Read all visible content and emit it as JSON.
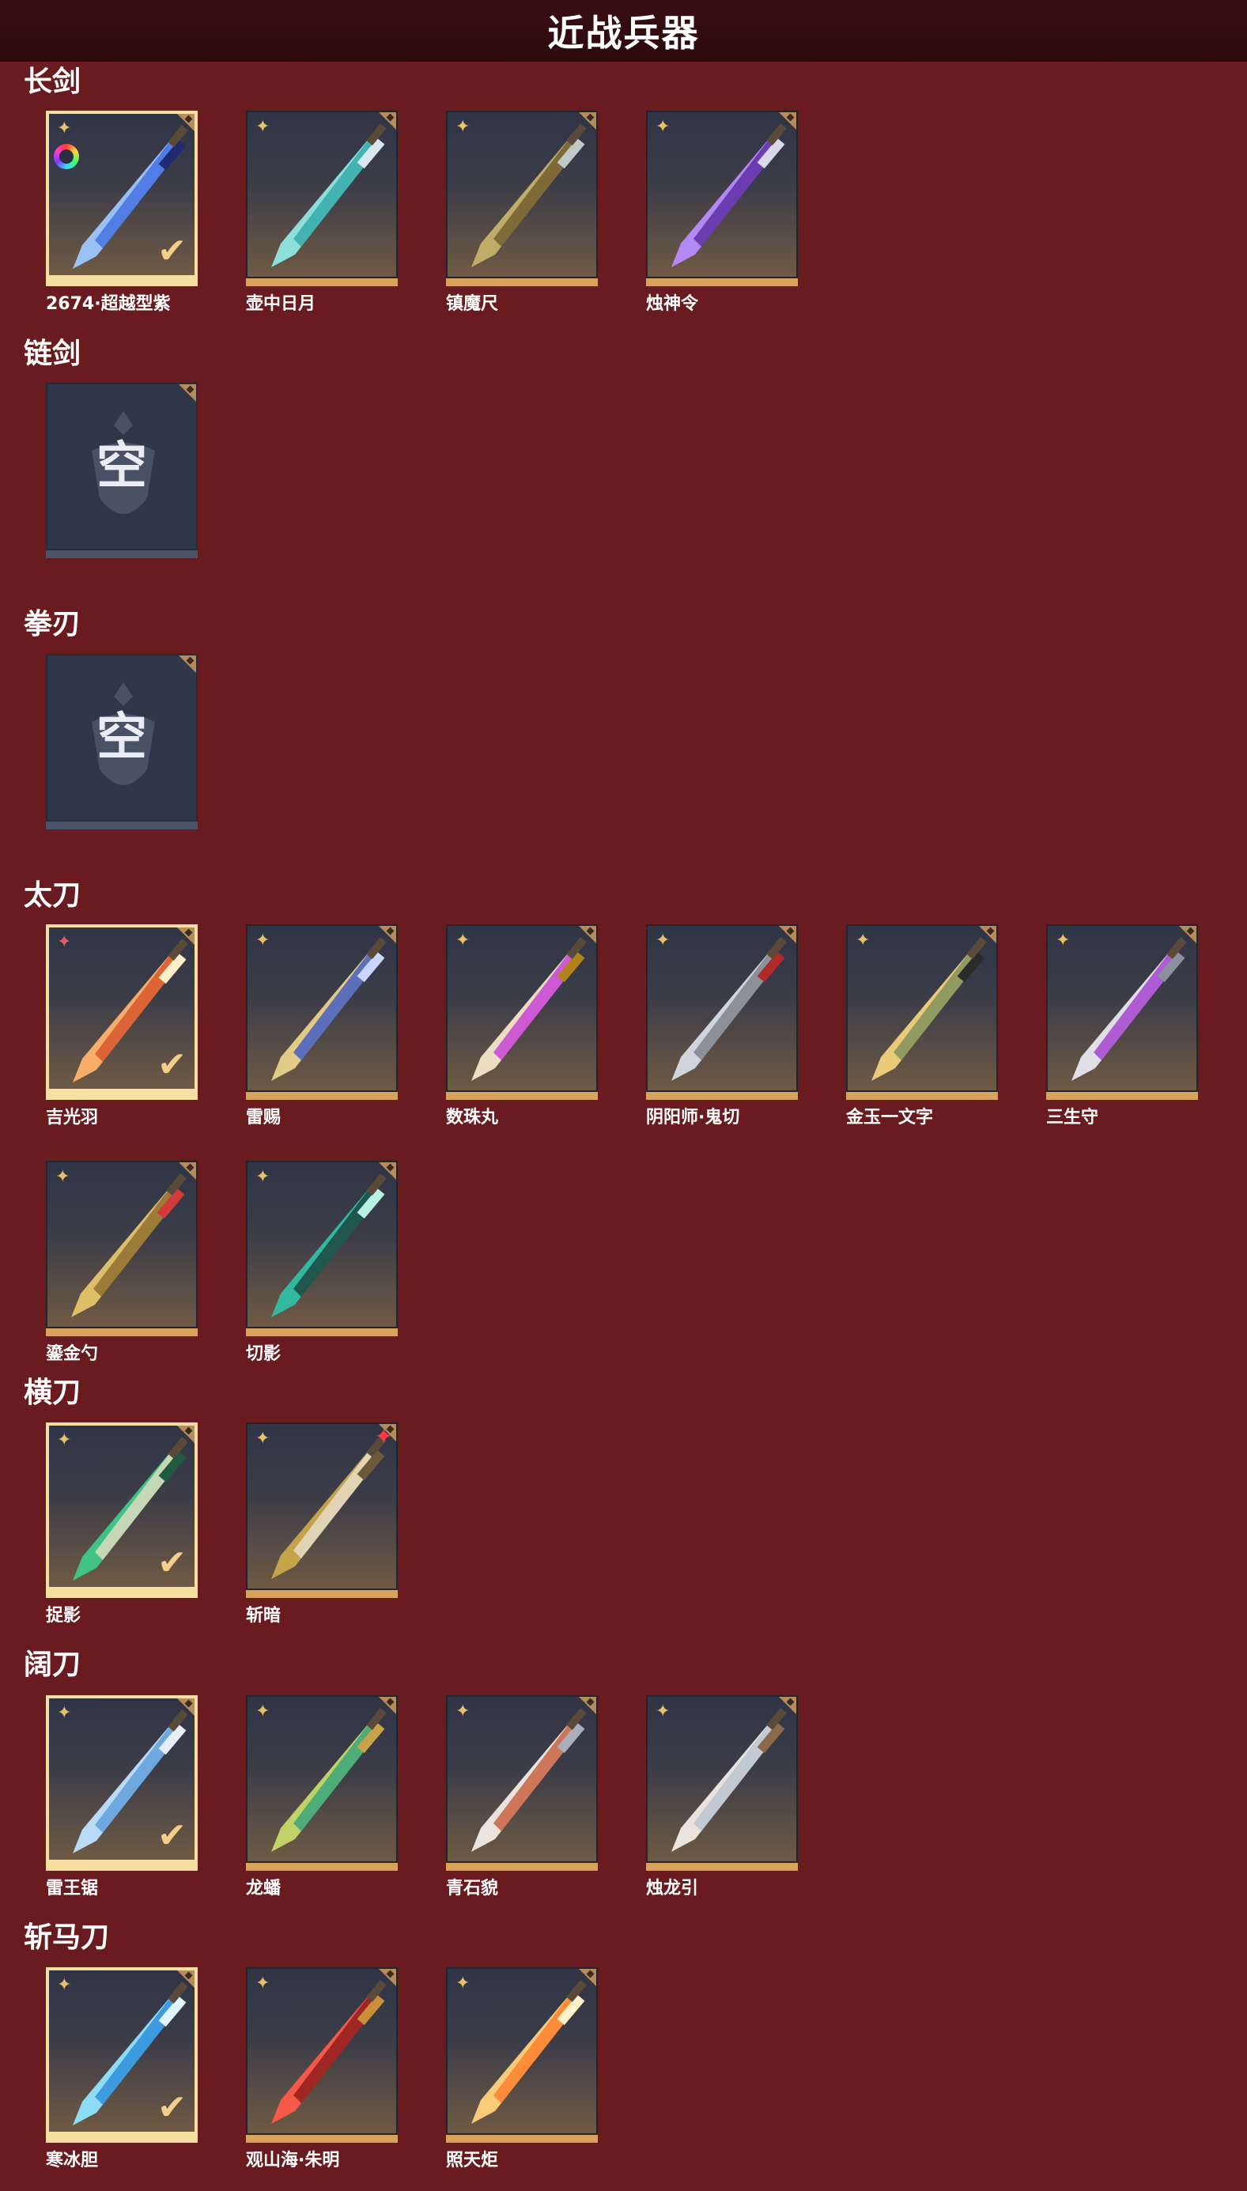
{
  "header": {
    "title": "近战兵器"
  },
  "categories": [
    {
      "name": "长剑",
      "items": [
        {
          "name": "2674·超越型紫",
          "selected": true,
          "rarity_icon": "gold-star-icon",
          "extra_icon": "rainbow-ring-icon"
        },
        {
          "name": "壶中日月",
          "rarity_icon": "gold-star-icon"
        },
        {
          "name": "镇魔尺",
          "rarity_icon": "gold-star-icon"
        },
        {
          "name": "烛神令",
          "rarity_icon": "gold-star-icon"
        }
      ]
    },
    {
      "name": "链剑",
      "items": [
        {
          "empty": true,
          "label": "空"
        }
      ]
    },
    {
      "name": "拳刃",
      "items": [
        {
          "empty": true,
          "label": "空"
        }
      ]
    },
    {
      "name": "太刀",
      "items": [
        {
          "name": "吉光羽",
          "selected": true,
          "rarity_icon": "red-star-icon"
        },
        {
          "name": "雷赐",
          "rarity_icon": "gold-star-icon"
        },
        {
          "name": "数珠丸",
          "rarity_icon": "gold-star-icon"
        },
        {
          "name": "阴阳师·鬼切",
          "rarity_icon": "gold-star-icon"
        },
        {
          "name": "金玉一文字",
          "rarity_icon": "gold-star-icon"
        },
        {
          "name": "三生守",
          "rarity_icon": "gold-star-icon"
        },
        {
          "name": "鎏金勺",
          "rarity_icon": "gold-star-icon"
        },
        {
          "name": "切影",
          "rarity_icon": "gold-star-icon"
        }
      ]
    },
    {
      "name": "横刀",
      "items": [
        {
          "name": "捉影",
          "selected": true,
          "rarity_icon": "gold-star-icon"
        },
        {
          "name": "斩暗",
          "rarity_icon": "gold-star-icon",
          "extra_icon": "red-badge-icon"
        }
      ]
    },
    {
      "name": "阔刀",
      "items": [
        {
          "name": "雷王锯",
          "selected": true,
          "rarity_icon": "gold-star-icon"
        },
        {
          "name": "龙蟠",
          "rarity_icon": "gold-star-icon"
        },
        {
          "name": "青石貌",
          "rarity_icon": "gold-star-icon"
        },
        {
          "name": "烛龙引",
          "rarity_icon": "gold-star-icon"
        }
      ]
    },
    {
      "name": "斩马刀",
      "items": [
        {
          "name": "寒冰胆",
          "selected": true,
          "rarity_icon": "gold-star-icon"
        },
        {
          "name": "观山海·朱明",
          "rarity_icon": "gold-star-icon"
        },
        {
          "name": "照天炬",
          "rarity_icon": "gold-star-icon"
        }
      ]
    }
  ],
  "colors": {
    "background": "#6a1b1f",
    "header_bg": "#2c0a0d",
    "selected_border": "#f6dfa0",
    "card_bar": "#d8a25a",
    "empty_tile": "#2f3648"
  }
}
